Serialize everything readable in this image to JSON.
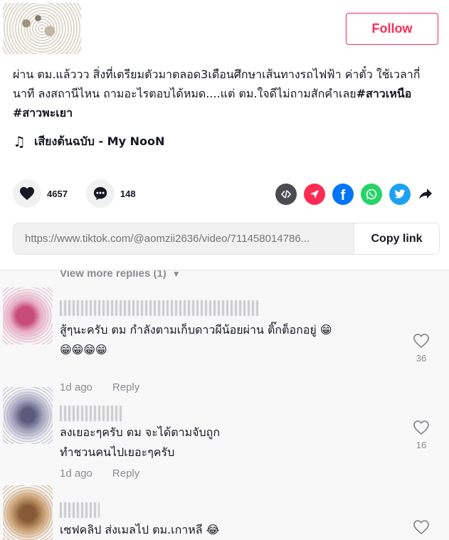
{
  "header": {
    "follow_label": "Follow"
  },
  "caption": {
    "text": "ผ่าน ตม.แล้ววว สิ่งที่เตรียมตัวมาตลอด3เดือนศึกษาเส้นทางรถไฟฟ้า ค่าตั๋ว ใช้เวลากี่นาที ลงสถานีไหน ถามอะไรตอบได้หมด....แต่ ตม.ใจดีไม่ถามสักคำเลย",
    "tag1": "#สาวเหนือ",
    "tag2": "#สาวพะเยา"
  },
  "music": {
    "title": "เสียงต้นฉบับ - My NooN"
  },
  "stats": {
    "likes": "4657",
    "comments": "148"
  },
  "share": {
    "icons": [
      "embed-icon",
      "send-icon",
      "facebook-icon",
      "whatsapp-icon",
      "twitter-icon",
      "share-arrow-icon"
    ]
  },
  "link": {
    "url": "https://www.tiktok.com/@aomzii2636/video/711458014786...",
    "copy_label": "Copy link"
  },
  "replies": {
    "view_more": "View more replies (1)"
  },
  "comments": [
    {
      "line1": "สู้ๆนะครับ ตม กำลังตามเก็บดาวผีน้อยผ่าน ติ๊กต็อกอยู่ 😁",
      "line2": "😁😁😁😁",
      "time": "1d ago",
      "reply": "Reply",
      "likes": "36"
    },
    {
      "line1": "ลงเยอะๆครับ ตม จะได้ตามจับถูก",
      "line2": "ทำชวนคนไปเยอะๆครับ",
      "time": "1d ago",
      "reply": "Reply",
      "likes": "16"
    },
    {
      "line1": "เซฟคลิป ส่งเมลไป ตม.เกาหลี 😂"
    }
  ],
  "colors": {
    "brand": "#fe2c55",
    "facebook": "#0075fa",
    "whatsapp": "#25d366",
    "twitter": "#1da1f2",
    "embed": "#4b4b51",
    "send": "#fe2c55"
  }
}
